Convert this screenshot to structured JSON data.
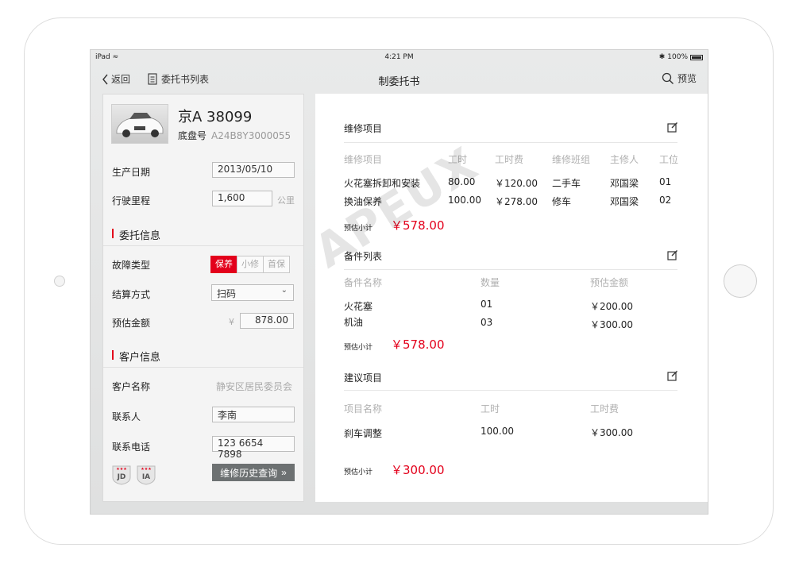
{
  "status_bar": {
    "device": "iPad",
    "time": "4:21 PM",
    "battery": "100%"
  },
  "nav": {
    "back": "返回",
    "list": "委托书列表",
    "title": "制委托书",
    "preview": "预览"
  },
  "vehicle": {
    "plate": "京A 38099",
    "chassis_label": "底盘号",
    "chassis_value": "A24B8Y3000055",
    "production_date_label": "生产日期",
    "production_date": "2013/05/10",
    "mileage_label": "行驶里程",
    "mileage": "1,600",
    "mileage_unit": "公里"
  },
  "commission": {
    "section_title": "委托信息",
    "fault_type_label": "故障类型",
    "fault_types": [
      "保养",
      "小修",
      "首保"
    ],
    "fault_type_selected": "保养",
    "payment_label": "结算方式",
    "payment_value": "扫码",
    "estimate_label": "预估金额",
    "currency": "¥",
    "estimate_value": "878.00"
  },
  "customer": {
    "section_title": "客户信息",
    "name_label": "客户名称",
    "name_value": "静安区居民委员会",
    "contact_label": "联系人",
    "contact_value": "李南",
    "phone_label": "联系电话",
    "phone_value": "123 6654 7898",
    "badges": [
      "JD",
      "IA"
    ],
    "history_button": "维修历史查询"
  },
  "repair": {
    "title": "维修项目",
    "headers": [
      "维修项目",
      "工时",
      "工时费",
      "维修班组",
      "主修人",
      "工位"
    ],
    "rows": [
      [
        "火花塞拆卸和安装",
        "80.00",
        "￥120.00",
        "二手车",
        "邓国梁",
        "01"
      ],
      [
        "换油保养",
        "100.00",
        "￥278.00",
        "修车",
        "邓国梁",
        "02"
      ]
    ],
    "subtotal_label": "预估小计",
    "subtotal": "￥578.00"
  },
  "parts": {
    "title": "备件列表",
    "headers": [
      "备件名称",
      "数量",
      "预估金额"
    ],
    "rows": [
      [
        "火花塞",
        "01",
        "￥200.00"
      ],
      [
        "机油",
        "03",
        "￥300.00"
      ]
    ],
    "subtotal_label": "预估小计",
    "subtotal": "￥578.00"
  },
  "suggest": {
    "title": "建议项目",
    "headers": [
      "项目名称",
      "工时",
      "工时费"
    ],
    "rows": [
      [
        "刹车调整",
        "100.00",
        "￥300.00"
      ]
    ],
    "subtotal_label": "预估小计",
    "subtotal": "￥300.00"
  },
  "watermark": "APEUX",
  "colors": {
    "accent": "#e3001b",
    "button": "#6d7172"
  }
}
